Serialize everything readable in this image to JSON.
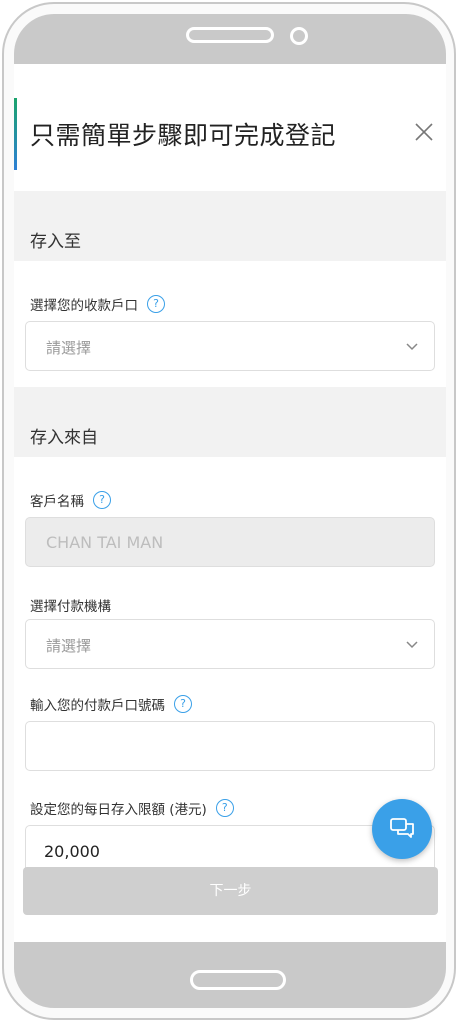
{
  "header": {
    "title": "只需簡單步驟即可完成登記"
  },
  "deposit_to": {
    "section_title": "存入至",
    "account_label": "選擇您的收款戶口",
    "account_placeholder": "請選擇"
  },
  "deposit_from": {
    "section_title": "存入來自",
    "customer_name_label": "客戶名稱",
    "customer_name_value": "CHAN TAI MAN",
    "institution_label": "選擇付款機構",
    "institution_placeholder": "請選擇",
    "account_number_label": "輸入您的付款戶口號碼",
    "account_number_value": "",
    "daily_limit_label": "設定您的每日存入限額 (港元)",
    "daily_limit_value": "20,000"
  },
  "help_glyph": "?",
  "next_button": "下一步",
  "colors": {
    "accent_top": "#1aa36b",
    "accent_bottom": "#2d7fd6",
    "help": "#3aa0e8",
    "chat_button": "#3aa0e8",
    "disabled_button": "#cfcfcf"
  },
  "icons": [
    "close-icon",
    "help-icon",
    "chevron-down-icon",
    "chat-icon"
  ]
}
